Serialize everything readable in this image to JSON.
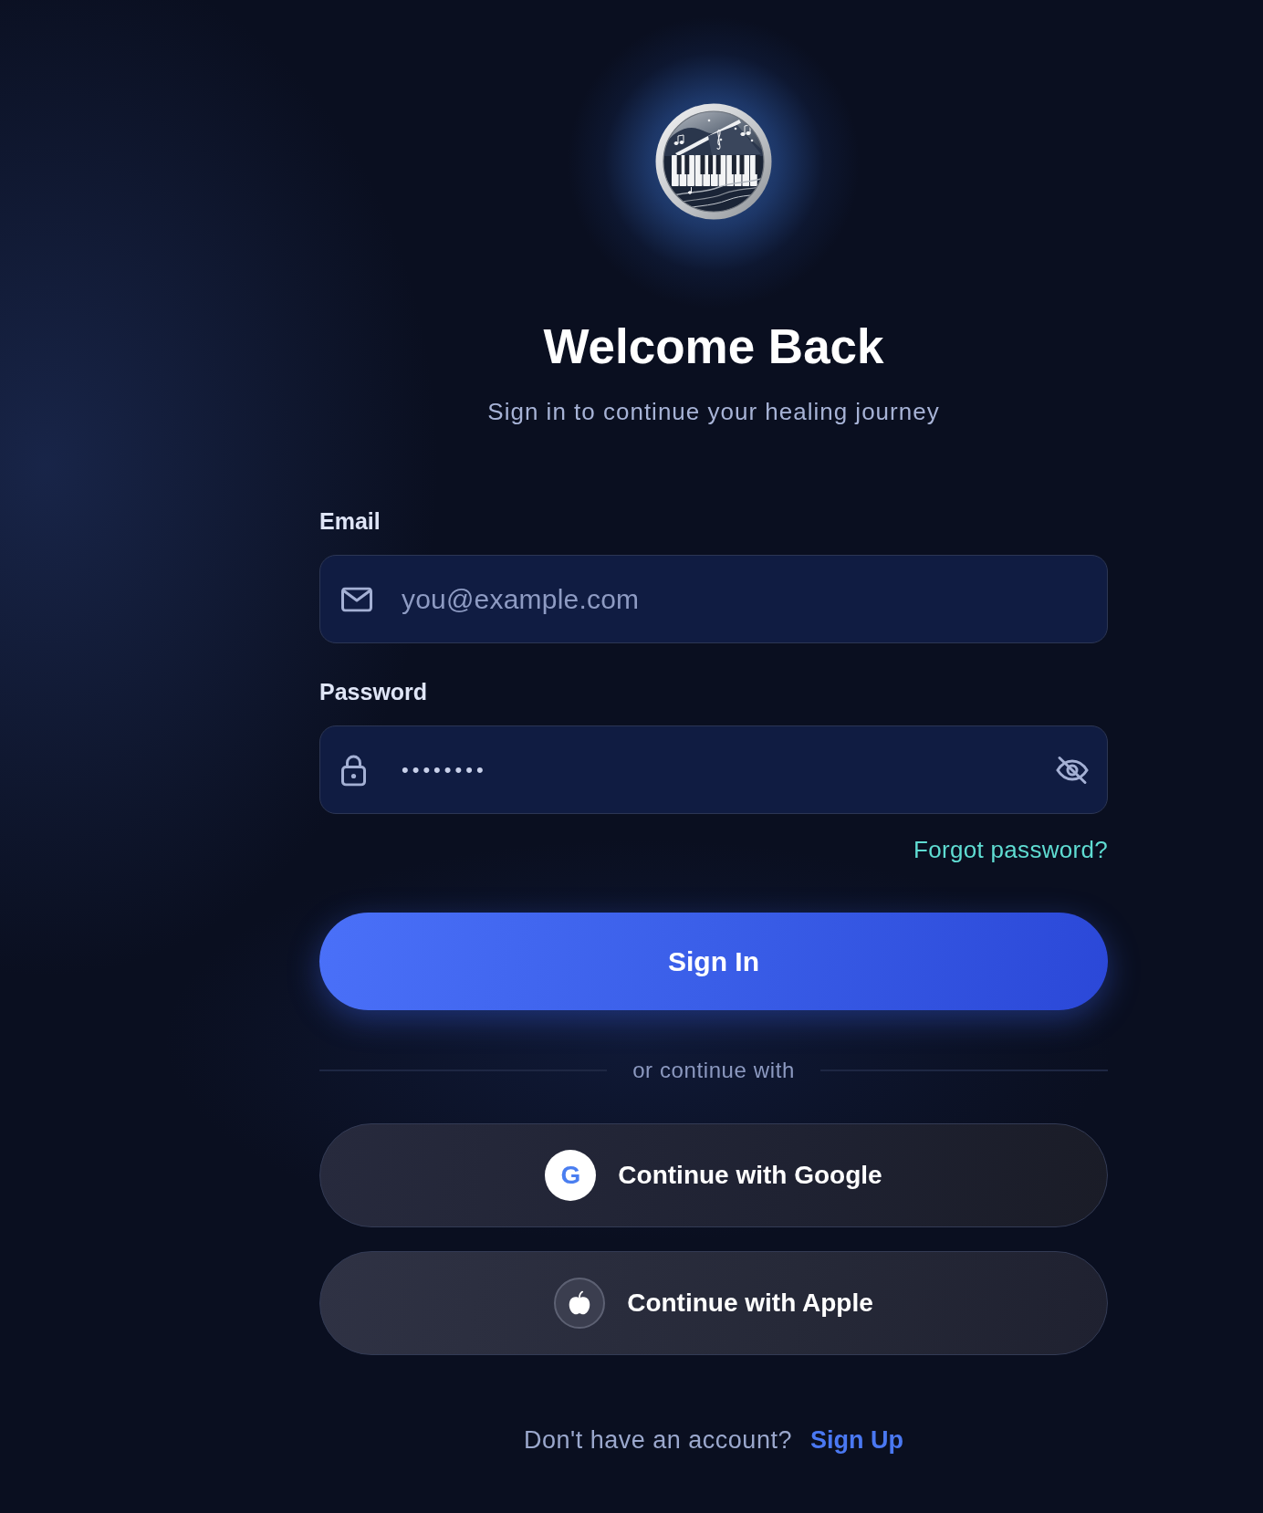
{
  "heading": {
    "title": "Welcome Back",
    "subtitle": "Sign in to continue your healing journey"
  },
  "form": {
    "fields": [
      {
        "kind": "email",
        "label": "Email",
        "placeholder": "you@example.com"
      },
      {
        "kind": "password",
        "label": "Password",
        "value": "••••••••",
        "show_password": false
      }
    ],
    "forgot_link": "Forgot password?",
    "submit": "Sign In"
  },
  "divider": "or continue with",
  "social_buttons": [
    {
      "kind": "google",
      "label": "Continue with Google",
      "badge": "G"
    },
    {
      "kind": "apple",
      "label": "Continue with Apple"
    }
  ],
  "footer": {
    "prompt": "Don't have an account?",
    "link": "Sign Up"
  }
}
